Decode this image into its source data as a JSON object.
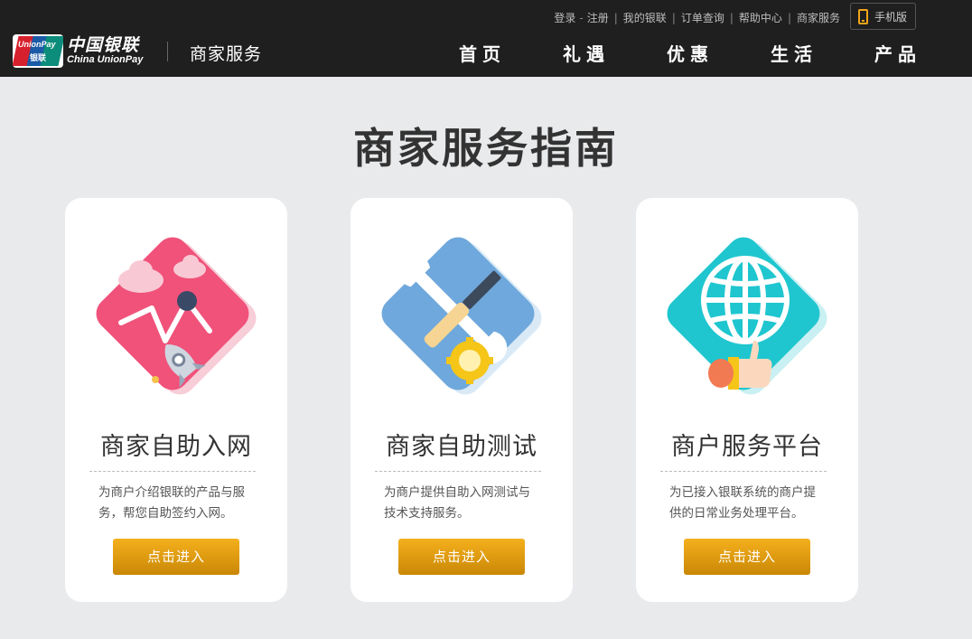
{
  "header": {
    "logo": {
      "badge_text": "UnionPay",
      "badge_cn": "银联",
      "cn": "中国银联",
      "en": "China UnionPay"
    },
    "section_title": "商家服务",
    "top_links": [
      "登录",
      "注册",
      "我的银联",
      "订单查询",
      "帮助中心",
      "商家服务"
    ],
    "mobile_label": "手机版",
    "nav": [
      "首页",
      "礼遇",
      "优惠",
      "生活",
      "产品"
    ]
  },
  "page_title": "商家服务指南",
  "cards": [
    {
      "title": "商家自助入网",
      "desc": "为商户介绍银联的产品与服务，帮您自助签约入网。",
      "button": "点击进入",
      "icon": "rocket-chart-icon",
      "color": "#f0527a"
    },
    {
      "title": "商家自助测试",
      "desc": "为商户提供自助入网测试与技术支持服务。",
      "button": "点击进入",
      "icon": "tools-icon",
      "color": "#6fa8dc"
    },
    {
      "title": "商户服务平台",
      "desc": "为已接入银联系统的商户提供的日常业务处理平台。",
      "button": "点击进入",
      "icon": "globe-thumbsup-icon",
      "color": "#1fc6cf"
    }
  ]
}
